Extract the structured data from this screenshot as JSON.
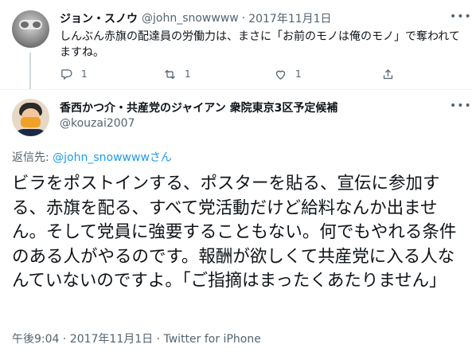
{
  "reply_tweet": {
    "display_name": "ジョン・スノウ",
    "handle": "@john_snowwww",
    "separator": "·",
    "date": "2017年11月1日",
    "text": "しんぶん赤旗の配達員の労働力は、まさに「お前のモノは俺のモノ」で奪われてますね。",
    "more_icon": "more-icon",
    "actions": {
      "reply_count": "1",
      "retweet_count": "1",
      "like_count": "1"
    }
  },
  "main_tweet": {
    "display_name": "香西かつ介・共産党のジャイアン 衆院東京3区予定候補",
    "handle": "@kouzai2007",
    "replying_to_prefix": "返信先: ",
    "replying_to_mention": "@john_snowwwwさん",
    "text": "ビラをポストインする、ポスターを貼る、宣伝に参加する、赤旗を配る、すべて党活動だけど給料なんか出ません。そして党員に強要することもない。何でもやれる条件のある人がやるのです。報酬が欲しくて共産党に入る人なんていないのですよ。「ご指摘はまったくあたりません」",
    "meta": "午後9:04 · 2017年11月1日 · Twitter for iPhone"
  },
  "colors": {
    "text_primary": "#0f1419",
    "text_secondary": "#536471",
    "link": "#1d9bf0",
    "thread_line": "#cfd9de",
    "divider": "#eff3f4"
  }
}
